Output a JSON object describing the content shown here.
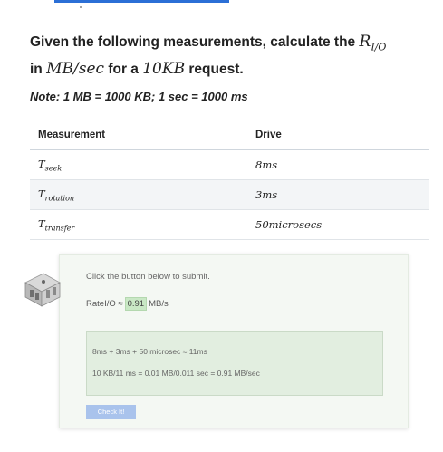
{
  "question": {
    "prefix": "Given the following measurements, calculate the ",
    "var_main": "R",
    "var_sub": "I/O",
    "in_word": "in ",
    "unit": "MB/sec",
    "for_word": " for a ",
    "size": "10KB",
    "suffix": " request."
  },
  "note": "Note: 1 MB = 1000 KB; 1 sec = 1000 ms",
  "table": {
    "headers": [
      "Measurement",
      "Drive"
    ],
    "rows": [
      {
        "main": "T",
        "sub": "seek",
        "value": "8ms"
      },
      {
        "main": "T",
        "sub": "rotation",
        "value": "3ms"
      },
      {
        "main": "T",
        "sub": "transfer",
        "value": "50microsecs"
      }
    ]
  },
  "quiz": {
    "instruction": "Click the button below to submit.",
    "answer_label": "RateI/O ≈",
    "answer_value": "0.91",
    "answer_unit": "MB/s",
    "solution_line1": "8ms + 3ms + 50 microsec ≈ 11ms",
    "solution_line2": "10 KB/11 ms = 0.01 MB/0.011 sec = 0.91 MB/sec",
    "check_label": "Check It!"
  }
}
